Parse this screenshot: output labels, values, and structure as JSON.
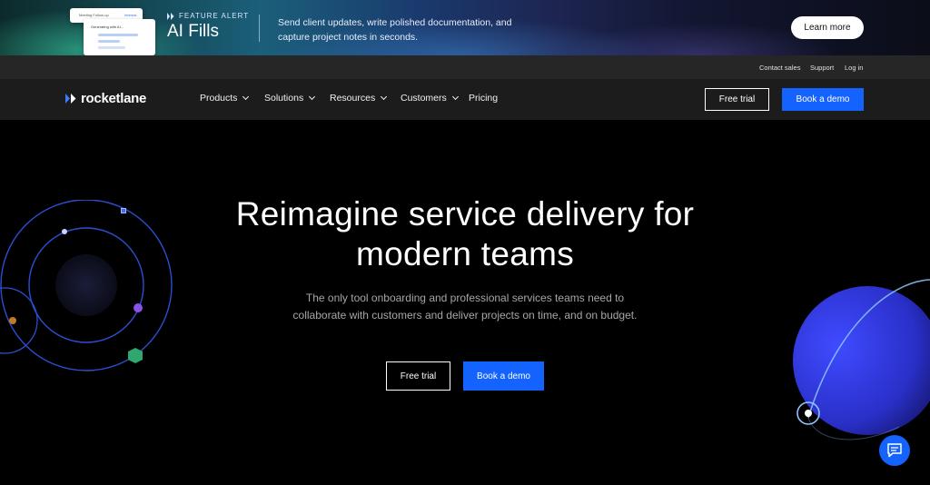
{
  "banner": {
    "label": "FEATURE ALERT",
    "title": "AI Fills",
    "description": "Send client updates, write polished documentation, and capture project notes in seconds.",
    "cta": "Learn more",
    "mock_header": "Meeting Follow-up",
    "mock_tag": "Internal",
    "mock_status": "Generating with AI..."
  },
  "utility": {
    "links": [
      "Contact sales",
      "Support",
      "Log in"
    ]
  },
  "nav": {
    "logo_text": "rocketlane",
    "items": [
      {
        "label": "Products",
        "has_menu": true
      },
      {
        "label": "Solutions",
        "has_menu": true
      },
      {
        "label": "Resources",
        "has_menu": true
      },
      {
        "label": "Customers",
        "has_menu": true
      },
      {
        "label": "Pricing",
        "has_menu": false
      }
    ],
    "free_trial": "Free trial",
    "book_demo": "Book a demo"
  },
  "hero": {
    "title_line1": "Reimagine service delivery for",
    "title_line2": "modern teams",
    "subtitle": "The only tool onboarding and professional services teams need to collaborate with customers and deliver projects on time, and on budget.",
    "free_trial": "Free trial",
    "book_demo": "Book a demo"
  },
  "colors": {
    "accent": "#1463ff",
    "background": "#000000",
    "nav_bg": "#1c1c1c",
    "utility_bg": "#262626"
  },
  "icons": {
    "logo": "rocketlane-chevrons-icon",
    "chat": "chat-bubble-icon",
    "menu_indicator": "chevron-down-icon"
  }
}
